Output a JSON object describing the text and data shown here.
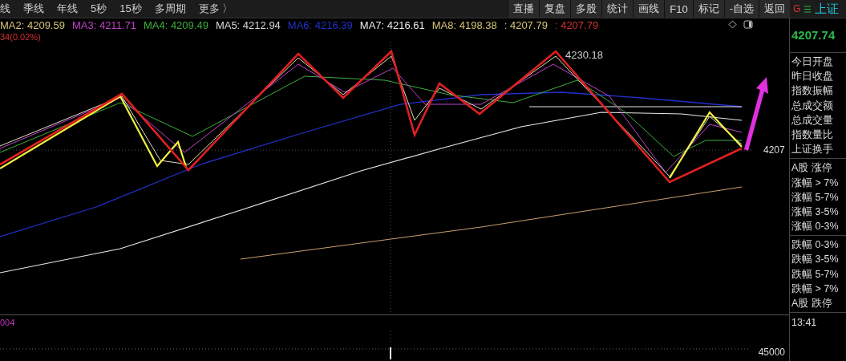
{
  "toolbar": {
    "periods": [
      {
        "label": "线"
      },
      {
        "label": "季线"
      },
      {
        "label": "年线"
      },
      {
        "label": "5秒"
      },
      {
        "label": "15秒"
      },
      {
        "label": "多周期"
      },
      {
        "label": "更多 〉"
      }
    ],
    "buttons": [
      {
        "label": "直播"
      },
      {
        "label": "复盘"
      },
      {
        "label": "多股"
      },
      {
        "label": "统计"
      },
      {
        "label": "画线"
      },
      {
        "label": "F10"
      },
      {
        "label": "标记"
      },
      {
        "label": "-自选"
      },
      {
        "label": "返回"
      }
    ]
  },
  "legend": [
    {
      "label": "MA2: 4209.59",
      "color": "#d6c27a"
    },
    {
      "label": "MA3: 4211.71",
      "color": "#c040c8"
    },
    {
      "label": "MA4: 4209.49",
      "color": "#3cae3c"
    },
    {
      "label": "MA5: 4212.94",
      "color": "#d8d8d8"
    },
    {
      "label": "MA6: 4216.39",
      "color": "#2230c8"
    },
    {
      "label": "MA7: 4216.61",
      "color": "#e8e8e8"
    },
    {
      "label": "MA8: 4198.38",
      "color": "#d6c27a"
    },
    {
      "label": ": 4207.79",
      "color": "#d6c27a"
    },
    {
      "label": ": 4207.79",
      "color": "#d03030"
    }
  ],
  "change": "34(0.02%)",
  "chart": {
    "peak_label": "4230.18",
    "price_axis_label": "4207"
  },
  "volume": {
    "value": "004",
    "axis_label": "45000"
  },
  "panel": {
    "badge": "G",
    "title": "上证",
    "price": "4207.74",
    "groups": [
      [
        "今日开盘",
        "昨日收盘",
        "指数振幅",
        "总成交额",
        "总成交量",
        "指数量比",
        "上证换手"
      ],
      [
        "A股 涨停",
        "涨幅 > 7%",
        "涨幅 5-7%",
        "涨幅 3-5%",
        "涨幅 0-3%"
      ],
      [
        "跌幅 0-3%",
        "跌幅 3-5%",
        "跌幅 5-7%",
        "跌幅 > 7%",
        "A股 跌停"
      ]
    ],
    "time": "13:41"
  }
}
